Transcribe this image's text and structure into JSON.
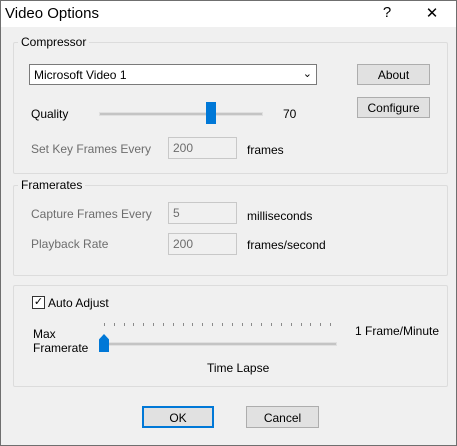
{
  "window": {
    "title": "Video Options",
    "help": "?",
    "close": "✕"
  },
  "compressor": {
    "legend": "Compressor",
    "selected": "Microsoft Video 1",
    "about_label": "About",
    "configure_label": "Configure",
    "quality_label": "Quality",
    "quality_value": "70",
    "quality_fraction": 0.7,
    "keyframes_label": "Set Key Frames Every",
    "keyframes_value": "200",
    "keyframes_unit": "frames"
  },
  "framerates": {
    "legend": "Framerates",
    "capture_label": "Capture Frames Every",
    "capture_value": "5",
    "capture_unit": "milliseconds",
    "playback_label": "Playback Rate",
    "playback_value": "200",
    "playback_unit": "frames/second"
  },
  "timelapse": {
    "auto_adjust_label": "Auto Adjust",
    "auto_adjust_checked": true,
    "check_glyph": "✓",
    "max_label_1": "Max",
    "max_label_2": "Framerate",
    "rate_value": "1 Frame/Minute",
    "time_lapse_label": "Time Lapse",
    "slider_fraction": 0
  },
  "footer": {
    "ok_label": "OK",
    "cancel_label": "Cancel"
  },
  "colors": {
    "accent": "#0078d7",
    "dialog_bg": "#f0f0f0",
    "focus_border": "#0078d7"
  }
}
